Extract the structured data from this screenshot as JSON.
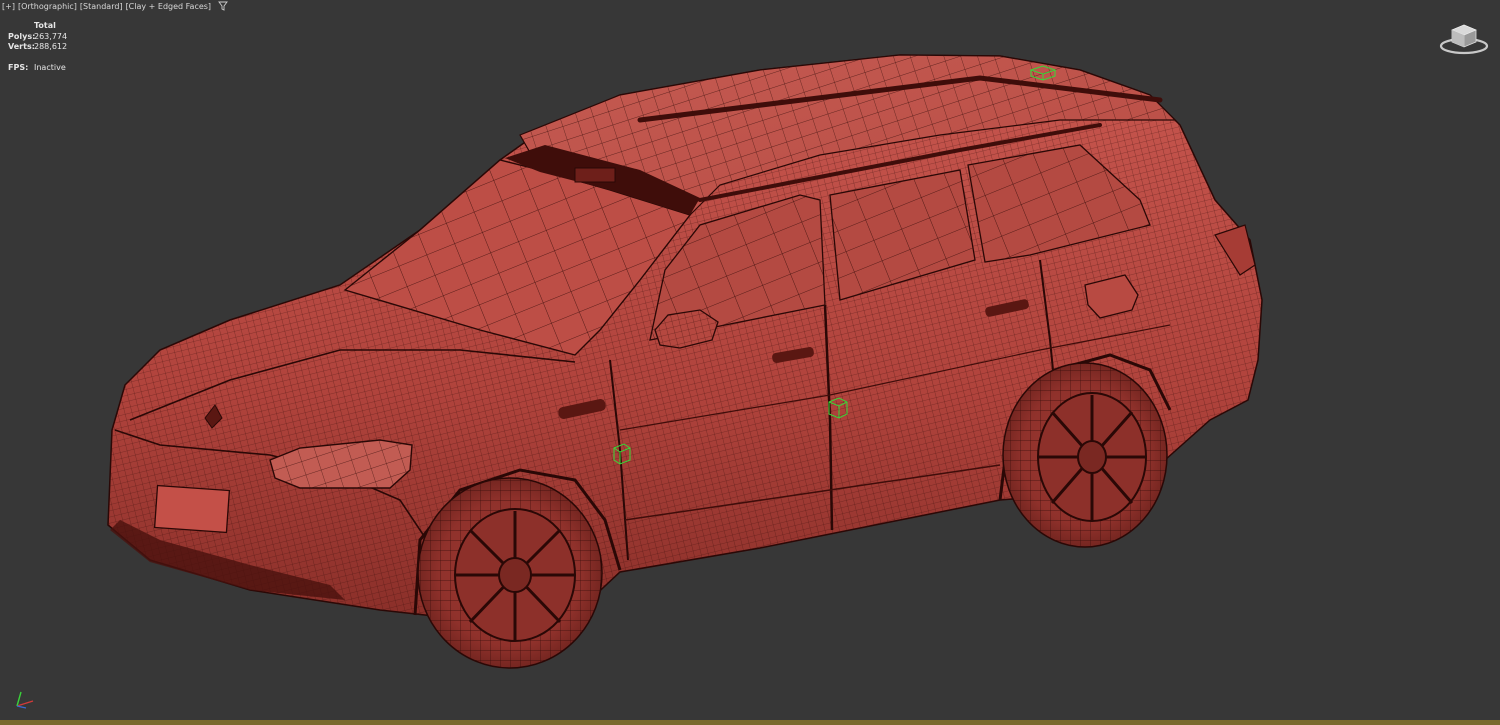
{
  "viewport": {
    "labels": [
      "[+]",
      "[Orthographic]",
      "[Standard]",
      "[Clay + Edged Faces]"
    ]
  },
  "stats": {
    "header": "Total",
    "polys_label": "Polys:",
    "polys_value": "263,774",
    "verts_label": "Verts:",
    "verts_value": "288,612",
    "fps_label": "FPS:",
    "fps_value": "Inactive"
  },
  "icons": {
    "filter": "filter-icon",
    "viewcube": "viewcube-icon",
    "axis": "axis-tripod-icon"
  },
  "colors": {
    "background": "#373737",
    "clay": "#b5453f",
    "wire": "#3a0e0b",
    "helper": "#38d838",
    "axis_x": "#d23a3a",
    "axis_y": "#3ad23a"
  }
}
